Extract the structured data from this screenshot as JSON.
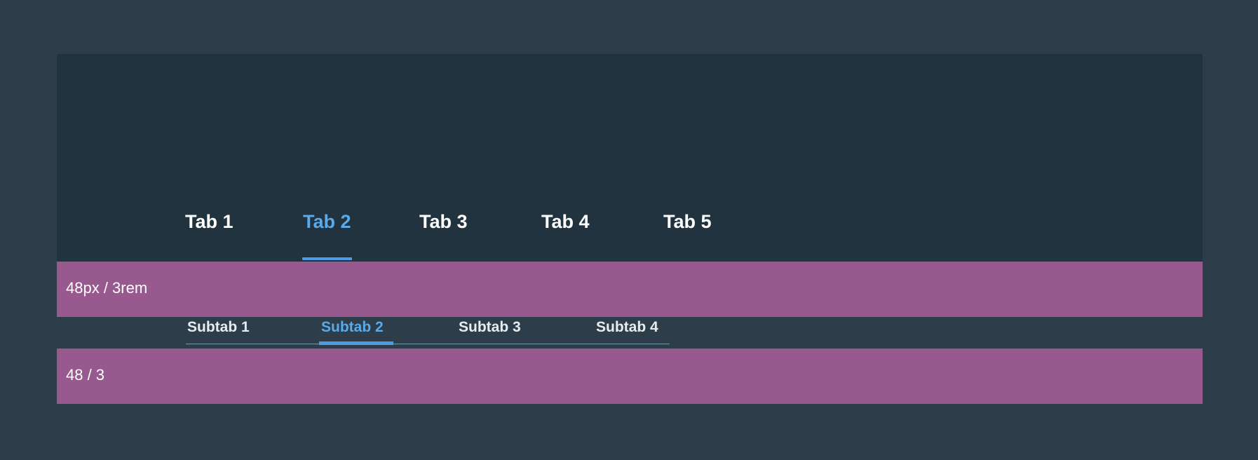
{
  "tabs": [
    {
      "label": "Tab 1",
      "active": false
    },
    {
      "label": "Tab 2",
      "active": true
    },
    {
      "label": "Tab 3",
      "active": false
    },
    {
      "label": "Tab 4",
      "active": false
    },
    {
      "label": "Tab 5",
      "active": false
    }
  ],
  "spacers": [
    {
      "label": "48px / 3rem"
    },
    {
      "label": "48 / 3"
    }
  ],
  "subtabs": [
    {
      "label": "Subtab 1",
      "active": false
    },
    {
      "label": "Subtab 2",
      "active": true
    },
    {
      "label": "Subtab 3",
      "active": false
    },
    {
      "label": "Subtab 4",
      "active": false
    }
  ],
  "colors": {
    "page_background": "#2d3e4a",
    "panel_background": "#21333f",
    "accent": "#5aa9e8",
    "spacer_band": "#985a8e"
  }
}
